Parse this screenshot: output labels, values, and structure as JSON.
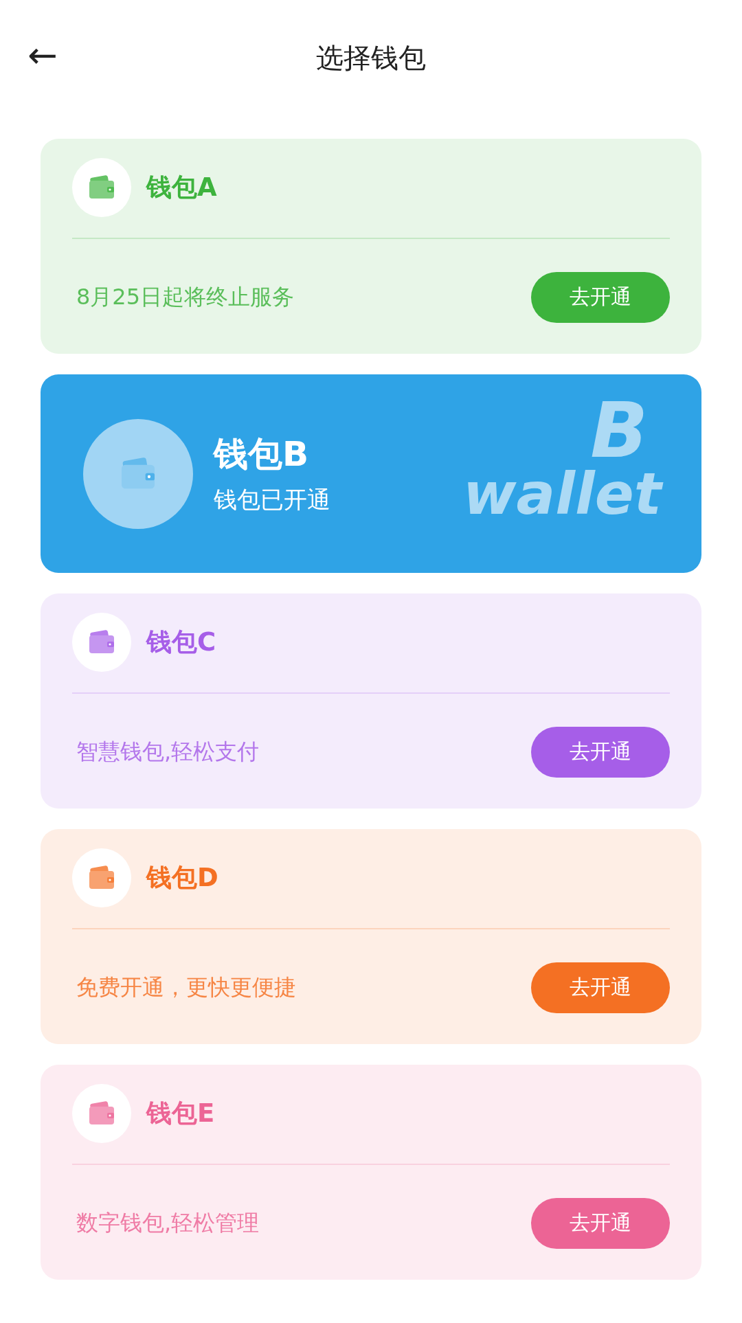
{
  "header": {
    "back_icon": "←",
    "title": "选择钱包"
  },
  "cards": [
    {
      "kind": "offer",
      "color": "#3db33d",
      "name": "钱包A",
      "description": "8月25日起将终止服务",
      "button": "去开通"
    },
    {
      "kind": "opened",
      "color": "#2fa3e6",
      "name": "钱包B",
      "description": "钱包已开通",
      "decor_letter": "B",
      "decor_word": "wallet"
    },
    {
      "kind": "offer",
      "color": "#a65ee8",
      "name": "钱包C",
      "description": "智慧钱包,轻松支付",
      "button": "去开通"
    },
    {
      "kind": "offer",
      "color": "#f47023",
      "name": "钱包D",
      "description": "免费开通，更快更便捷",
      "button": "去开通"
    },
    {
      "kind": "offer",
      "color": "#ec6495",
      "name": "钱包E",
      "description": "数字钱包,轻松管理",
      "button": "去开通"
    }
  ]
}
